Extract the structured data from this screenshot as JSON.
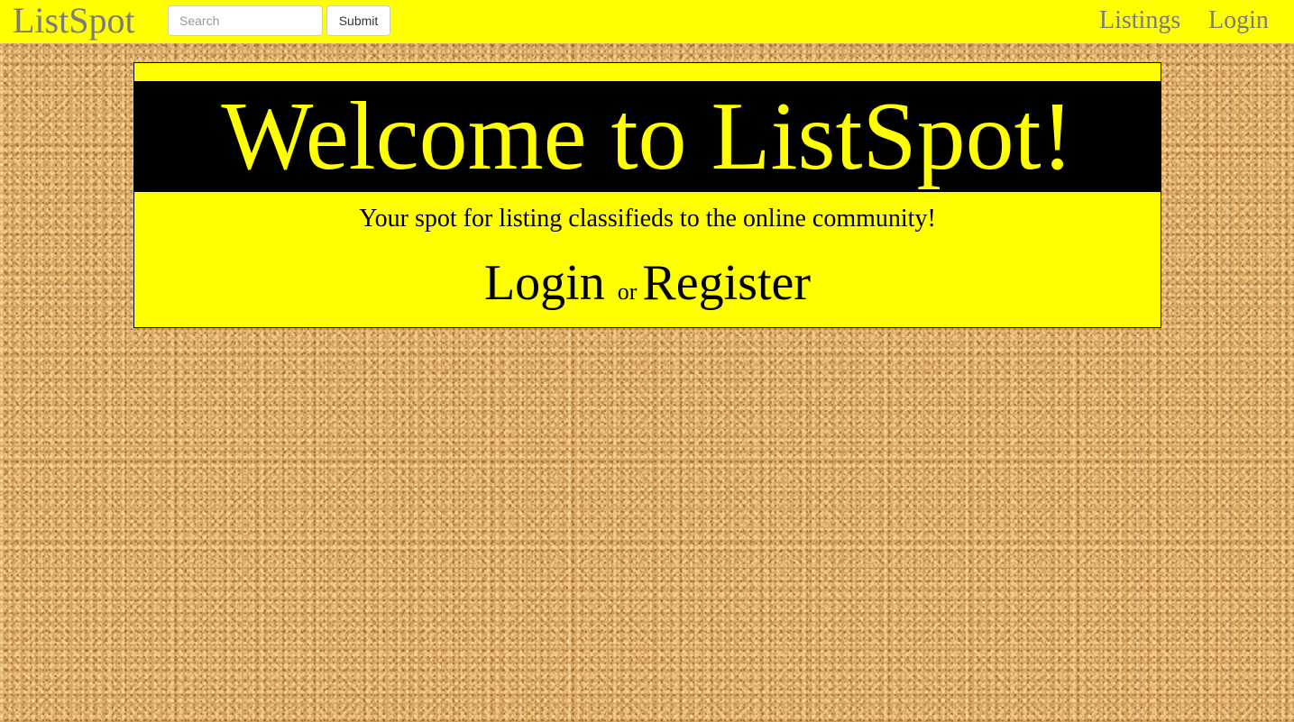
{
  "navbar": {
    "brand": "ListSpot",
    "search": {
      "placeholder": "Search",
      "value": ""
    },
    "submit_label": "Submit",
    "links": {
      "listings": "Listings",
      "login": "Login"
    }
  },
  "hero": {
    "title": "Welcome to ListSpot!",
    "tagline": "Your spot for listing classifieds to the online community!",
    "login_label": "Login",
    "or_label": "or",
    "register_label": "Register"
  },
  "colors": {
    "navbar_bg": "#ffff00",
    "panel_bg": "#ffff00",
    "banner_bg": "#000000",
    "banner_text": "#ffff00",
    "nav_text": "#7b7b7b",
    "page_bg": "#d9a55c"
  }
}
